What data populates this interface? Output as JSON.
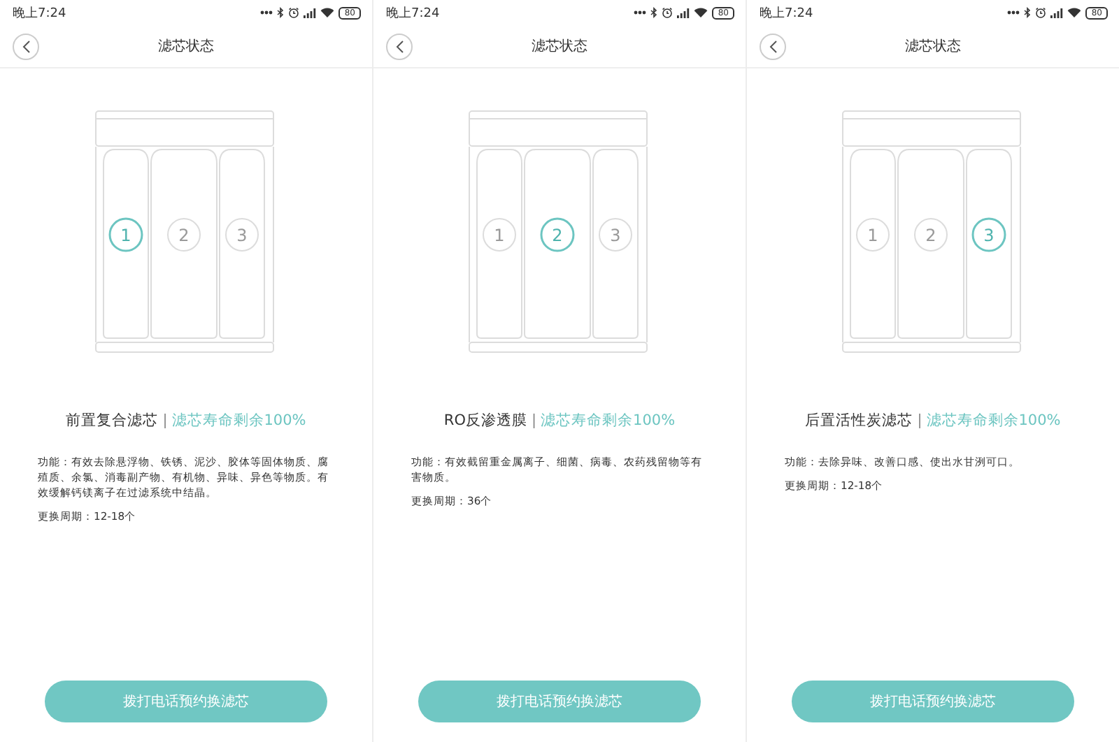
{
  "screens": [
    {
      "status_bar": {
        "time": "晚上7:24",
        "battery": "80"
      },
      "header": {
        "title": "滤芯状态"
      },
      "filters": [
        {
          "label": "1",
          "selected": true
        },
        {
          "label": "2",
          "selected": false
        },
        {
          "label": "3",
          "selected": false
        }
      ],
      "filter_name": "前置复合滤芯",
      "separator": "|",
      "life_text": "滤芯寿命剩余100%",
      "description": "功能：有效去除悬浮物、铁锈、泥沙、胶体等固体物质、腐殖质、余氯、消毒副产物、有机物、异味、异色等物质。有效缓解钙镁离子在过滤系统中结晶。",
      "period": "更换周期：12-18个",
      "button": "拨打电话预约换滤芯"
    },
    {
      "status_bar": {
        "time": "晚上7:24",
        "battery": "80"
      },
      "header": {
        "title": "滤芯状态"
      },
      "filters": [
        {
          "label": "1",
          "selected": false
        },
        {
          "label": "2",
          "selected": true
        },
        {
          "label": "3",
          "selected": false
        }
      ],
      "filter_name": "RO反渗透膜",
      "separator": "|",
      "life_text": "滤芯寿命剩余100%",
      "description": "功能：有效截留重金属离子、细菌、病毒、农药残留物等有害物质。",
      "period": "更换周期：36个",
      "button": "拨打电话预约换滤芯"
    },
    {
      "status_bar": {
        "time": "晚上7:24",
        "battery": "80"
      },
      "header": {
        "title": "滤芯状态"
      },
      "filters": [
        {
          "label": "1",
          "selected": false
        },
        {
          "label": "2",
          "selected": false
        },
        {
          "label": "3",
          "selected": true
        }
      ],
      "filter_name": "后置活性炭滤芯",
      "separator": "|",
      "life_text": "滤芯寿命剩余100%",
      "description": "功能：去除异味、改善口感、使出水甘洌可口。",
      "period": "更换周期：12-18个",
      "button": "拨打电话预约换滤芯"
    }
  ]
}
